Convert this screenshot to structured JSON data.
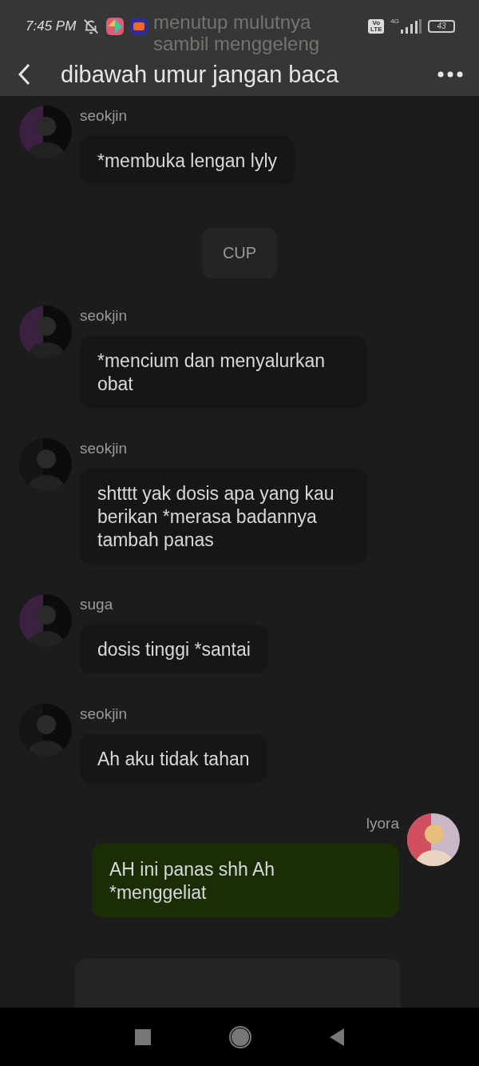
{
  "status_bar": {
    "time": "7:45 PM",
    "volte": "Vo LTE",
    "network": "4G",
    "battery": "43"
  },
  "header": {
    "title": "dibawah umur jangan baca",
    "under_text": "menutup mulutnya sambil menggeleng"
  },
  "messages": [
    {
      "kind": "incoming",
      "sender": "seokjin",
      "text": "*membuka lengan lyly"
    },
    {
      "kind": "system",
      "text": "CUP"
    },
    {
      "kind": "incoming",
      "sender": "seokjin",
      "text": "*mencium dan menyalurkan obat"
    },
    {
      "kind": "incoming",
      "sender": "seokjin",
      "text": "shtttt yak dosis apa yang kau berikan *merasa badannya tambah panas"
    },
    {
      "kind": "incoming",
      "sender": "suga",
      "text": "dosis tinggi *santai"
    },
    {
      "kind": "incoming",
      "sender": "seokjin",
      "text": "Ah aku tidak tahan"
    },
    {
      "kind": "outgoing",
      "sender": "lyora",
      "text": "AH ini panas shh Ah *menggeliat"
    },
    {
      "kind": "cut_off"
    }
  ]
}
